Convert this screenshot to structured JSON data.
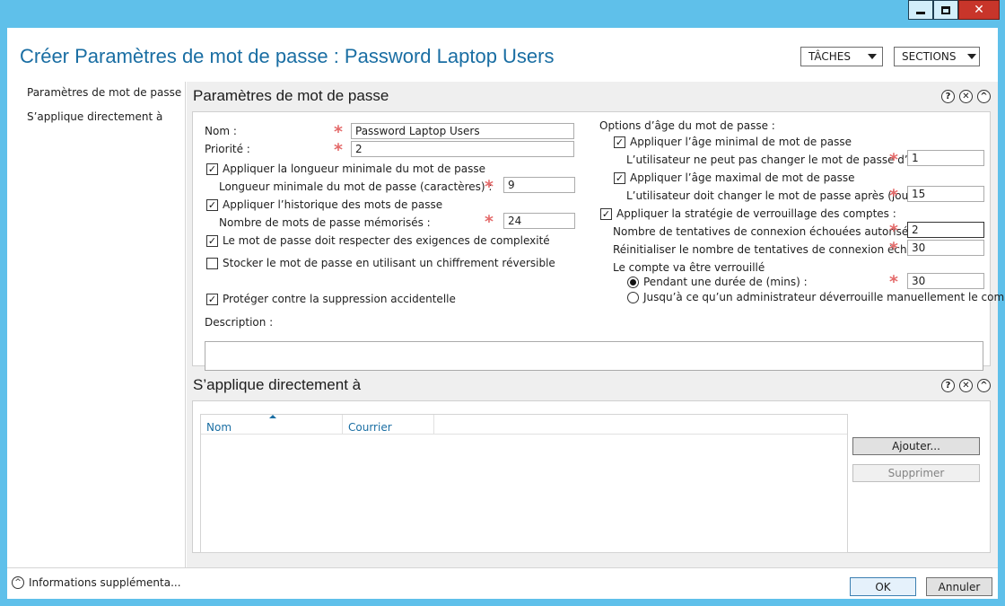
{
  "window": {
    "icons": [
      "minimize-icon",
      "maximize-icon",
      "close-icon"
    ],
    "close_glyph": "✕"
  },
  "header": {
    "title": "Créer Paramètres de mot de passe : Password Laptop Users",
    "tasks_label": "TÂCHES",
    "sections_label": "SECTIONS"
  },
  "nav": {
    "items": [
      "Paramètres de mot de passe",
      "S’applique directement à"
    ]
  },
  "section_icons": {
    "help": "?",
    "clear": "✕",
    "collapse": "^"
  },
  "password_settings": {
    "title": "Paramètres de mot de passe",
    "name_label": "Nom :",
    "name_value": "Password Laptop Users",
    "priority_label": "Priorité :",
    "priority_value": "2",
    "min_length_check": "Appliquer la longueur minimale du mot de passe",
    "min_length_label": "Longueur minimale du mot de passe (caractères) :",
    "min_length_value": "9",
    "history_check": "Appliquer l’historique des mots de passe",
    "history_label": "Nombre de mots de passe mémorisés :",
    "history_value": "24",
    "complexity_check": "Le mot de passe doit respecter des exigences de complexité",
    "reversible_check": "Stocker le mot de passe en utilisant un chiffrement réversible",
    "protect_check": "Protéger contre la suppression accidentelle",
    "description_label": "Description :",
    "age_title": "Options d’âge du mot de passe :",
    "min_age_check": "Appliquer l’âge minimal de mot de passe",
    "min_age_label": "L’utilisateur ne peut pas changer le mot de passe d’ic...",
    "min_age_value": "1",
    "max_age_check": "Appliquer l’âge maximal de mot de passe",
    "max_age_label": "L’utilisateur doit changer le mot de passe après (jour...",
    "max_age_value": "15",
    "lockout_check": "Appliquer la stratégie de verrouillage des comptes :",
    "attempts_label": "Nombre de tentatives de connexion échouées autorisé :",
    "attempts_value": "2",
    "reset_label": "Réinitialiser le nombre de tentatives de connexion écho...",
    "reset_value": "30",
    "locked_label": "Le compte va être verrouillé",
    "duration_radio": "Pendant une durée de (mins) :",
    "duration_value": "30",
    "manual_radio": "Jusqu’à ce qu’un administrateur déverrouille manuellement le compte",
    "checkmark": "✓",
    "required_mark": "*"
  },
  "applies_to": {
    "title": "S’applique directement à",
    "columns": [
      "Nom",
      "Courrier"
    ],
    "add_button": "Ajouter...",
    "remove_button": "Supprimer"
  },
  "footer": {
    "more_info": "Informations supplémenta...",
    "more_icon": "^",
    "ok": "OK",
    "cancel": "Annuler"
  }
}
